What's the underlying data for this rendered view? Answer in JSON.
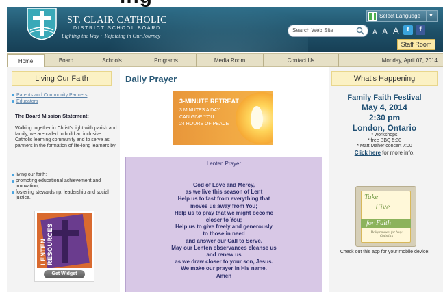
{
  "page_top_cropped_text": "ing",
  "header": {
    "brand_name": "ST. CLAIR CATHOLIC",
    "brand_sub": "DISTRICT SCHOOL BOARD",
    "tagline": "Lighting the Way ~ Rejoicing in Our Journey",
    "search_placeholder": "Search Web Site",
    "select_language": "Select Language",
    "text_size": [
      "A",
      "A",
      "A"
    ],
    "staff_room": "Staff Room",
    "twitter_glyph": "t",
    "facebook_glyph": "f"
  },
  "nav": {
    "items": [
      "Home",
      "Board",
      "Schools",
      "Programs",
      "Media Room",
      "Contact Us"
    ],
    "active_index": 0,
    "date": "Monday, April 07, 2014"
  },
  "left": {
    "title": "Living Our Faith",
    "links": [
      "Parents and Community Partners",
      "Educators"
    ],
    "mission_heading": "The Board Mission Statement:",
    "mission_body": "Walking together in Christ's light with parish and family, we are called to build an inclusive Catholic learning community and to serve as partners in the formation of life-long learners by:",
    "mission_list": [
      "living our faith;",
      "promoting educational achievement and innovation;",
      "fostering stewardship, leadership and social justice."
    ],
    "widget_text": "LENTEN RESOURCES",
    "widget_button": "Get Widget"
  },
  "center": {
    "title": "Daily Prayer",
    "retreat": {
      "title": "3-MINUTE RETREAT",
      "lines": [
        "3 MINUTES A DAY",
        "CAN GIVE YOU",
        "24 HOURS OF PEACE"
      ]
    },
    "prayer_title": "Lenten Prayer",
    "prayer_lines": [
      "God of Love and Mercy,",
      "as we live this season of Lent",
      "Help us to fast from everything that",
      "moves us away from You;",
      "Help us to pray that we might become",
      "closer to You;",
      "Help us to give freely and generously",
      "to those in need",
      "and answer our Call to Serve.",
      "May our Lenten observances cleanse us",
      "and renew us",
      "as we draw closer to your son, Jesus.",
      "We make our prayer in His name.",
      "Amen"
    ]
  },
  "right": {
    "title": "What's Happening",
    "event_name": "Family Faith Festival",
    "event_date": "May 4, 2014",
    "event_time": "2:30 pm",
    "event_place": "London, Ontario",
    "event_details": [
      "* workshops",
      "* free BBQ 5:30",
      "* Matt Maher concert 7:00"
    ],
    "click_link": "Click here",
    "click_rest": " for more info.",
    "app_title_lines": [
      "Take",
      "Five",
      "for Faith"
    ],
    "app_caption": "Daily renewal for busy Catholics",
    "app_note": "Check out this app for your mobile device!"
  },
  "colors": {
    "header_blue": "#1e5068",
    "title_band": "#fbf1c4",
    "prayer_bg": "#d8c8e6",
    "link_blue": "#1f4f73"
  }
}
